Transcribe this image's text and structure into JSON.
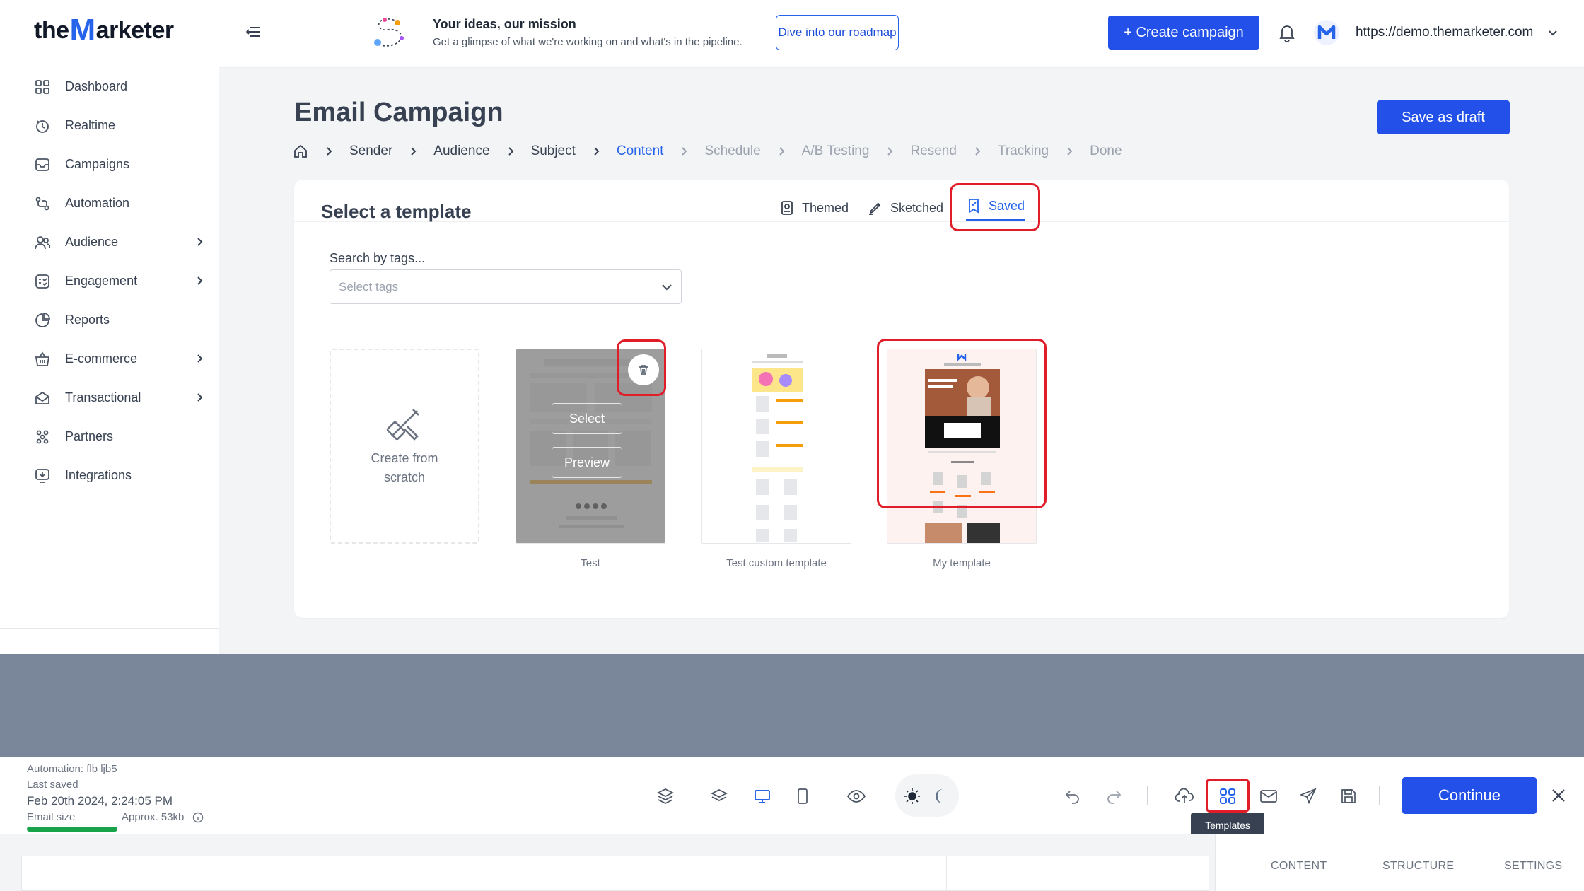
{
  "brand": {
    "logo_pre": "the",
    "logo_m": "M",
    "logo_post": "arketer"
  },
  "sidebar": {
    "items": [
      {
        "label": "Dashboard",
        "icon": "grid-icon",
        "has_children": false
      },
      {
        "label": "Realtime",
        "icon": "realtime-icon",
        "has_children": false
      },
      {
        "label": "Campaigns",
        "icon": "campaigns-icon",
        "has_children": false
      },
      {
        "label": "Automation",
        "icon": "automation-icon",
        "has_children": false
      },
      {
        "label": "Audience",
        "icon": "audience-icon",
        "has_children": true
      },
      {
        "label": "Engagement",
        "icon": "engagement-icon",
        "has_children": true
      },
      {
        "label": "Reports",
        "icon": "reports-icon",
        "has_children": false
      },
      {
        "label": "E-commerce",
        "icon": "basket-icon",
        "has_children": true
      },
      {
        "label": "Transactional",
        "icon": "envelope-icon",
        "has_children": true
      },
      {
        "label": "Partners",
        "icon": "partners-icon",
        "has_children": false
      },
      {
        "label": "Integrations",
        "icon": "integrations-icon",
        "has_children": false
      }
    ]
  },
  "header": {
    "mission_title": "Your ideas, our mission",
    "mission_sub": "Get a glimpse of what we're working on and what's in the pipeline.",
    "roadmap_label": "Dive into our roadmap",
    "create_label": "+ Create campaign",
    "account_url": "https://demo.themarketer.com"
  },
  "page": {
    "title": "Email Campaign",
    "save_draft_label": "Save as draft",
    "breadcrumbs": [
      {
        "label": "Sender",
        "state": "done"
      },
      {
        "label": "Audience",
        "state": "done"
      },
      {
        "label": "Subject",
        "state": "done"
      },
      {
        "label": "Content",
        "state": "active"
      },
      {
        "label": "Schedule",
        "state": "future"
      },
      {
        "label": "A/B Testing",
        "state": "future"
      },
      {
        "label": "Resend",
        "state": "future"
      },
      {
        "label": "Tracking",
        "state": "future"
      },
      {
        "label": "Done",
        "state": "future"
      }
    ]
  },
  "templates": {
    "title": "Select a template",
    "tabs": [
      {
        "label": "Themed",
        "icon": "themed-icon"
      },
      {
        "label": "Sketched",
        "icon": "pen-icon"
      },
      {
        "label": "Saved",
        "icon": "bookmark-icon",
        "active": true
      }
    ],
    "search_label": "Search by tags...",
    "search_placeholder": "Select tags",
    "scratch_label_1": "Create from",
    "scratch_label_2": "scratch",
    "select_label": "Select",
    "preview_label": "Preview",
    "items": [
      {
        "name": "Test"
      },
      {
        "name": "Test custom template"
      },
      {
        "name": "My template"
      }
    ]
  },
  "toolbar": {
    "automation": "Automation: flb ljb5",
    "last_saved_label": "Last saved",
    "last_saved_value": "Feb 20th 2024, 2:24:05 PM",
    "email_size_label": "Email size",
    "email_size_value": "Approx. 53kb",
    "continue_label": "Continue",
    "tooltip": "Templates"
  },
  "right_tabs": [
    "CONTENT",
    "STRUCTURE",
    "SETTINGS"
  ],
  "colors": {
    "accent": "#2250e8",
    "highlight": "#e11d2a",
    "band": "#7a8699"
  }
}
